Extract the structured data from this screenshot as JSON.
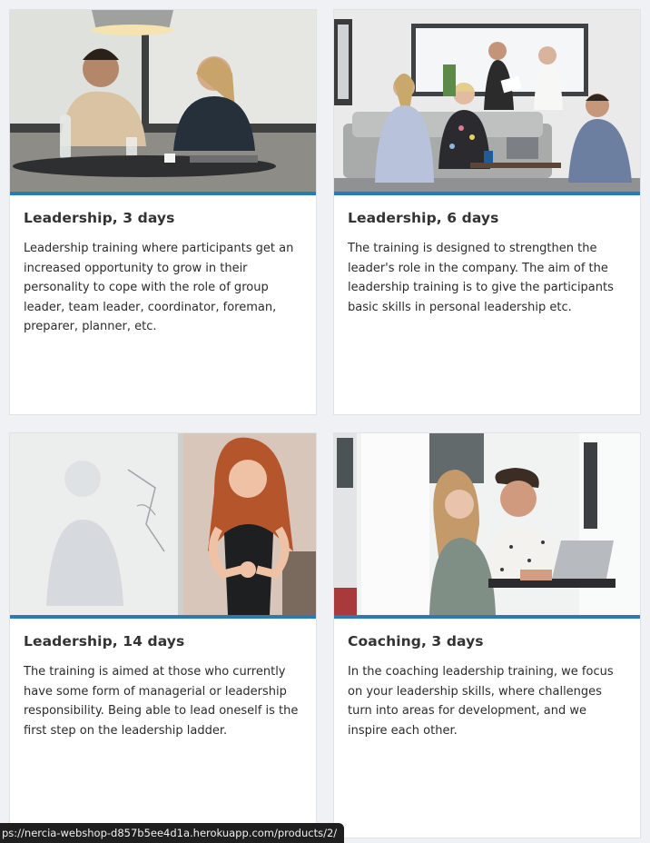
{
  "products": [
    {
      "title": "Leadership, 3 days",
      "description": "Leadership training where participants get an increased opportunity to grow in their personality to cope with the role of group leader, team leader, coordinator, foreman, preparer, planner, etc.",
      "image": "two-men-at-cafe-table-photo"
    },
    {
      "title": "Leadership, 6 days",
      "description": "The training is designed to strengthen the leader's role in the company. The aim of the leadership training is to give the participants basic skills in personal leadership etc.",
      "image": "group-meeting-in-lounge-photo"
    },
    {
      "title": "Leadership, 14 days",
      "description": "The training is aimed at those who currently have some form of managerial or leadership responsibility. Being able to lead oneself is the first step on the leadership ladder.",
      "image": "woman-presenting-at-whiteboard-photo"
    },
    {
      "title": "Coaching, 3 days",
      "description": "In the coaching leadership training, we focus on your leadership skills, where challenges turn into areas for development, and we inspire each other.",
      "image": "coaching-session-at-laptop-photo"
    }
  ],
  "status_bar": {
    "url": "ps://nercia-webshop-d857b5ee4d1a.herokuapp.com/products/2/"
  },
  "colors": {
    "accent_bar": "#2a7ab8",
    "page_background": "#eff1f4",
    "card_background": "#ffffff"
  }
}
